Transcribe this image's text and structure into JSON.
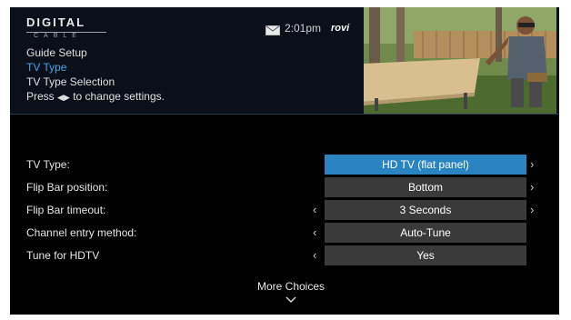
{
  "header": {
    "logo_main": "DIGITAL",
    "logo_sub": "CABLE",
    "time": "2:01pm",
    "brand": "rovi"
  },
  "breadcrumb": {
    "line1": "Guide Setup",
    "line2": "TV Type",
    "line3": "TV Type Selection",
    "line4_prefix": "Press",
    "line4_suffix": "to change settings."
  },
  "settings": {
    "tv_type": {
      "label": "TV Type:",
      "value": "HD TV (flat panel)"
    },
    "flip_bar_position": {
      "label": "Flip Bar position:",
      "value": "Bottom"
    },
    "flip_bar_timeout": {
      "label": "Flip Bar timeout:",
      "value": "3 Seconds"
    },
    "channel_entry": {
      "label": "Channel entry method:",
      "value": "Auto-Tune"
    },
    "tune_hdtv": {
      "label": "Tune for HDTV",
      "value": "Yes"
    }
  },
  "more_choices": "More Choices",
  "colors": {
    "accent": "#2b84c2",
    "highlight_text": "#3fa8e6",
    "value_bg": "#3a3a3a"
  },
  "icons": [
    "mail-icon",
    "left-right-arrows-icon",
    "chevron-left-icon",
    "chevron-right-icon",
    "chevron-down-icon"
  ]
}
